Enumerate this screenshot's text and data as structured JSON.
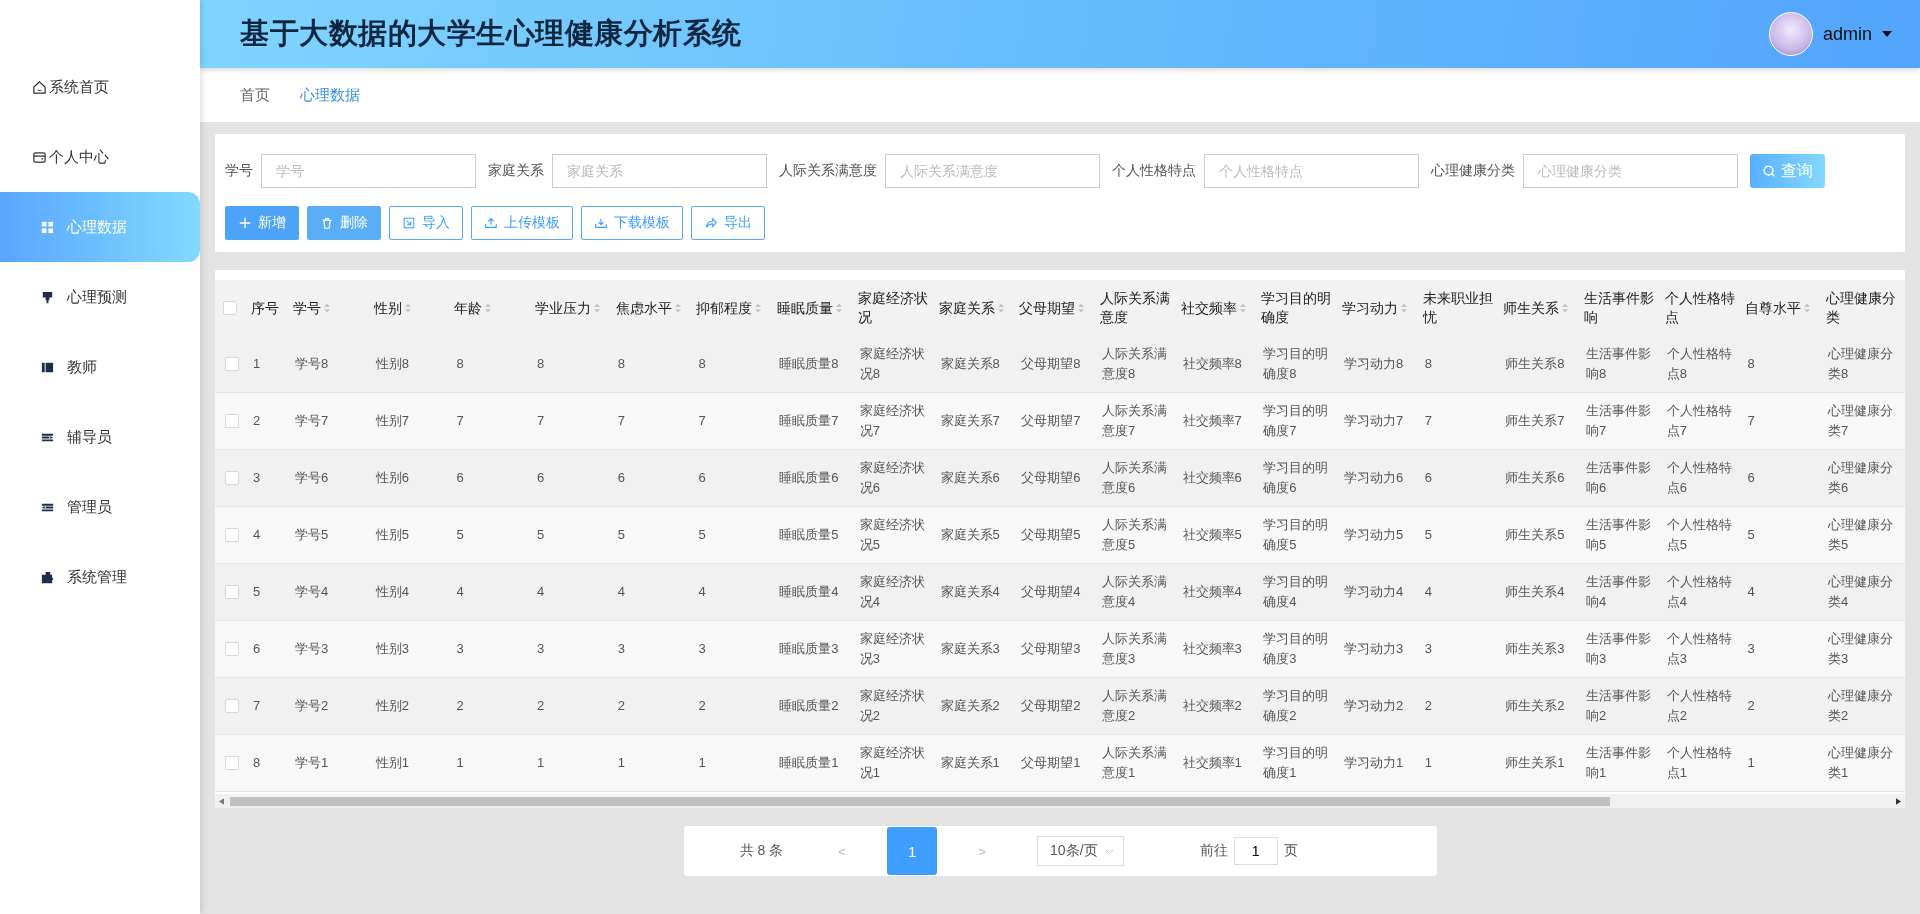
{
  "sidebar": {
    "items": [
      {
        "label": "系统首页",
        "selected": false
      },
      {
        "label": "个人中心",
        "selected": false
      },
      {
        "label": "心理数据",
        "selected": true
      },
      {
        "label": "心理预测",
        "selected": false
      },
      {
        "label": "教师",
        "selected": false
      },
      {
        "label": "辅导员",
        "selected": false
      },
      {
        "label": "管理员",
        "selected": false
      },
      {
        "label": "系统管理",
        "selected": false
      }
    ]
  },
  "header": {
    "title": "基于大数据的大学生心理健康分析系统",
    "user": "admin"
  },
  "breadcrumb": [
    {
      "label": "首页",
      "selected": false
    },
    {
      "label": "心理数据",
      "selected": true
    }
  ],
  "search": {
    "fields": [
      {
        "label": "学号",
        "placeholder": "学号"
      },
      {
        "label": "家庭关系",
        "placeholder": "家庭关系"
      },
      {
        "label": "人际关系满意度",
        "placeholder": "人际关系满意度"
      },
      {
        "label": "个人性格特点",
        "placeholder": "个人性格特点"
      },
      {
        "label": "心理健康分类",
        "placeholder": "心理健康分类"
      }
    ],
    "button": "查询"
  },
  "actions": [
    {
      "label": "新增",
      "kind": "primary"
    },
    {
      "label": "删除",
      "kind": "danger"
    },
    {
      "label": "导入",
      "kind": "plain"
    },
    {
      "label": "上传模板",
      "kind": "plain"
    },
    {
      "label": "下载模板",
      "kind": "plain"
    },
    {
      "label": "导出",
      "kind": "plain"
    }
  ],
  "table": {
    "all_checked": false,
    "columns": [
      {
        "label": "序号",
        "sortable": false
      },
      {
        "label": "学号",
        "sortable": true
      },
      {
        "label": "性别",
        "sortable": true
      },
      {
        "label": "年龄",
        "sortable": true
      },
      {
        "label": "学业压力",
        "sortable": true
      },
      {
        "label": "焦虑水平",
        "sortable": true
      },
      {
        "label": "抑郁程度",
        "sortable": true
      },
      {
        "label": "睡眠质量",
        "sortable": true
      },
      {
        "label": "家庭经济状况",
        "sortable": false
      },
      {
        "label": "家庭关系",
        "sortable": true
      },
      {
        "label": "父母期望",
        "sortable": true
      },
      {
        "label": "人际关系满意度",
        "sortable": false
      },
      {
        "label": "社交频率",
        "sortable": true
      },
      {
        "label": "学习目的明确度",
        "sortable": false
      },
      {
        "label": "学习动力",
        "sortable": true
      },
      {
        "label": "未来职业担忧",
        "sortable": false
      },
      {
        "label": "师生关系",
        "sortable": true
      },
      {
        "label": "生活事件影响",
        "sortable": false
      },
      {
        "label": "个人性格特点",
        "sortable": false
      },
      {
        "label": "自尊水平",
        "sortable": true
      },
      {
        "label": "心理健康分类",
        "sortable": false
      }
    ],
    "rows": [
      {
        "checked": false,
        "cells": [
          "1",
          "学号8",
          "性别8",
          "8",
          "8",
          "8",
          "8",
          "睡眠质量8",
          "家庭经济状况8",
          "家庭关系8",
          "父母期望8",
          "人际关系满意度8",
          "社交频率8",
          "学习目的明确度8",
          "学习动力8",
          "8",
          "师生关系8",
          "生活事件影响8",
          "个人性格特点8",
          "8",
          "心理健康分类8"
        ]
      },
      {
        "checked": false,
        "cells": [
          "2",
          "学号7",
          "性别7",
          "7",
          "7",
          "7",
          "7",
          "睡眠质量7",
          "家庭经济状况7",
          "家庭关系7",
          "父母期望7",
          "人际关系满意度7",
          "社交频率7",
          "学习目的明确度7",
          "学习动力7",
          "7",
          "师生关系7",
          "生活事件影响7",
          "个人性格特点7",
          "7",
          "心理健康分类7"
        ]
      },
      {
        "checked": false,
        "cells": [
          "3",
          "学号6",
          "性别6",
          "6",
          "6",
          "6",
          "6",
          "睡眠质量6",
          "家庭经济状况6",
          "家庭关系6",
          "父母期望6",
          "人际关系满意度6",
          "社交频率6",
          "学习目的明确度6",
          "学习动力6",
          "6",
          "师生关系6",
          "生活事件影响6",
          "个人性格特点6",
          "6",
          "心理健康分类6"
        ]
      },
      {
        "checked": false,
        "cells": [
          "4",
          "学号5",
          "性别5",
          "5",
          "5",
          "5",
          "5",
          "睡眠质量5",
          "家庭经济状况5",
          "家庭关系5",
          "父母期望5",
          "人际关系满意度5",
          "社交频率5",
          "学习目的明确度5",
          "学习动力5",
          "5",
          "师生关系5",
          "生活事件影响5",
          "个人性格特点5",
          "5",
          "心理健康分类5"
        ]
      },
      {
        "checked": false,
        "cells": [
          "5",
          "学号4",
          "性别4",
          "4",
          "4",
          "4",
          "4",
          "睡眠质量4",
          "家庭经济状况4",
          "家庭关系4",
          "父母期望4",
          "人际关系满意度4",
          "社交频率4",
          "学习目的明确度4",
          "学习动力4",
          "4",
          "师生关系4",
          "生活事件影响4",
          "个人性格特点4",
          "4",
          "心理健康分类4"
        ]
      },
      {
        "checked": false,
        "cells": [
          "6",
          "学号3",
          "性别3",
          "3",
          "3",
          "3",
          "3",
          "睡眠质量3",
          "家庭经济状况3",
          "家庭关系3",
          "父母期望3",
          "人际关系满意度3",
          "社交频率3",
          "学习目的明确度3",
          "学习动力3",
          "3",
          "师生关系3",
          "生活事件影响3",
          "个人性格特点3",
          "3",
          "心理健康分类3"
        ]
      },
      {
        "checked": false,
        "cells": [
          "7",
          "学号2",
          "性别2",
          "2",
          "2",
          "2",
          "2",
          "睡眠质量2",
          "家庭经济状况2",
          "家庭关系2",
          "父母期望2",
          "人际关系满意度2",
          "社交频率2",
          "学习目的明确度2",
          "学习动力2",
          "2",
          "师生关系2",
          "生活事件影响2",
          "个人性格特点2",
          "2",
          "心理健康分类2"
        ]
      },
      {
        "checked": false,
        "cells": [
          "8",
          "学号1",
          "性别1",
          "1",
          "1",
          "1",
          "1",
          "睡眠质量1",
          "家庭经济状况1",
          "家庭关系1",
          "父母期望1",
          "人际关系满意度1",
          "社交频率1",
          "学习目的明确度1",
          "学习动力1",
          "1",
          "师生关系1",
          "生活事件影响1",
          "个人性格特点1",
          "1",
          "心理健康分类1"
        ]
      }
    ]
  },
  "pagination": {
    "total": "共 8 条",
    "prev": "<",
    "pages": [
      {
        "label": "1",
        "selected": true
      }
    ],
    "next": ">",
    "page_size": "10条/页",
    "goto_label": "前往",
    "goto_value": "1",
    "goto_suffix": "页"
  }
}
